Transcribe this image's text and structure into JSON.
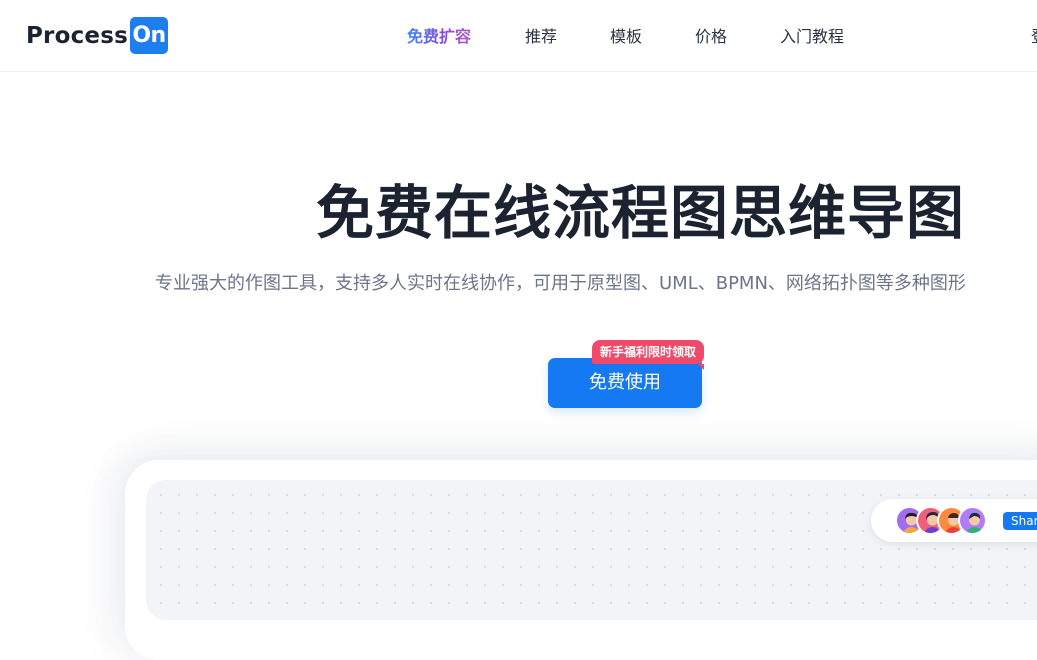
{
  "header": {
    "logo": {
      "text": "Process",
      "box_text": "On",
      "brand_color": "#1d7ef0"
    },
    "nav": [
      {
        "label": "免费扩容",
        "highlight": true
      },
      {
        "label": "推荐"
      },
      {
        "label": "模板"
      },
      {
        "label": "价格"
      },
      {
        "label": "入门教程"
      }
    ],
    "login_partial": "登"
  },
  "hero": {
    "title": "免费在线流程图思维导图",
    "subtitle": "专业强大的作图工具，支持多人实时在线协作，可用于原型图、UML、BPMN、网络拓扑图等多种图形",
    "cta": {
      "label": "免费使用",
      "badge": "新手福利限时领取",
      "color": "#1479f3",
      "badge_color": "#f1496a"
    }
  },
  "preview": {
    "collaborators": [
      {
        "icon": "user-avatar-icon",
        "bg": "#a06cf0"
      },
      {
        "icon": "user-avatar-icon",
        "bg": "#f0607a"
      },
      {
        "icon": "user-avatar-icon",
        "bg": "#ff8a3d"
      },
      {
        "icon": "user-avatar-icon",
        "bg": "#b07cf6"
      }
    ],
    "share_label": "Share"
  }
}
